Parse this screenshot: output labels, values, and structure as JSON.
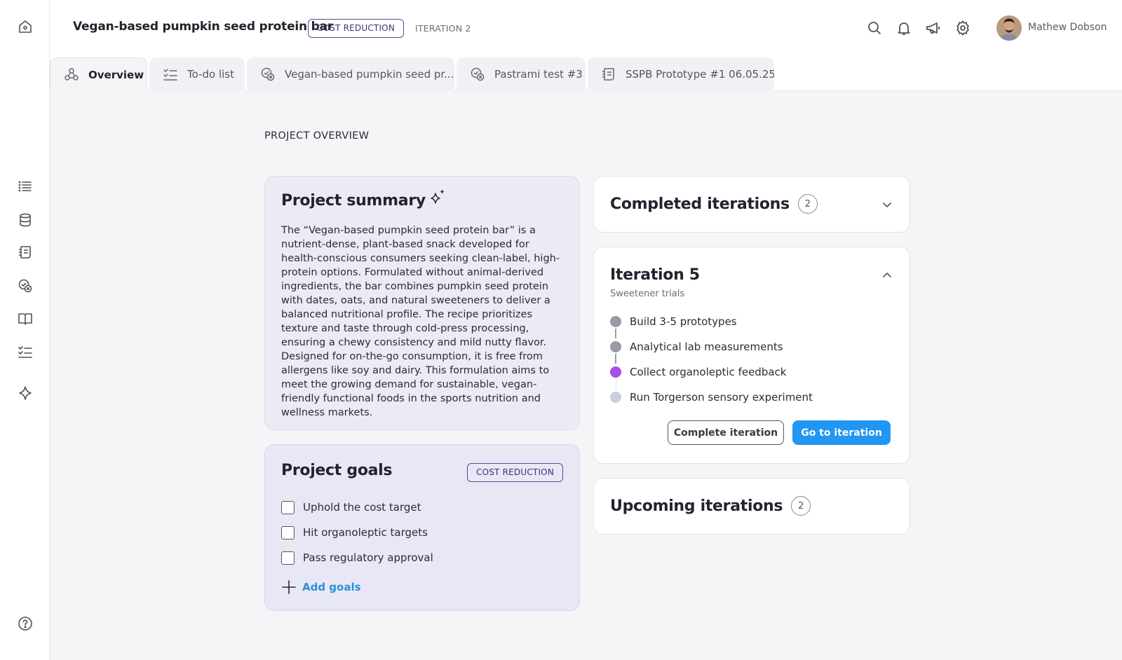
{
  "header": {
    "title": "Vegan-based pumpkin seed protein bar",
    "badge": "COST REDUCTION",
    "iteration": "ITERATION 2",
    "user_name": "Mathew Dobson"
  },
  "tabs": [
    {
      "label": "Overview",
      "icon": "molecule-icon",
      "active": true
    },
    {
      "label": "To-do list",
      "icon": "checklist-icon",
      "active": false
    },
    {
      "label": "Vegan-based pumpkin seed pr...",
      "icon": "flask-check-icon",
      "active": false
    },
    {
      "label": "Pastrami test #3",
      "icon": "flask-check-icon",
      "active": false
    },
    {
      "label": "SSPB Prototype #1 06.05.25",
      "icon": "recipe-icon",
      "active": false
    }
  ],
  "overview": {
    "section_title": "PROJECT OVERVIEW",
    "summary": {
      "title": "Project summary",
      "text": "The “Vegan-based pumpkin seed protein bar” is a nutrient-dense, plant-based snack developed for health-conscious consumers seeking clean-label, high-protein options. Formulated without animal-derived ingredients, the bar combines pumpkin seed protein with dates, oats, and natural sweeteners to deliver a balanced nutritional profile. The recipe prioritizes texture and taste through cold-press processing, ensuring a chewy consistency and mild nutty flavor. Designed for on-the-go consumption, it is free from allergens like soy and dairy. This formulation aims to meet the growing demand for sustainable, vegan-friendly functional foods in the sports nutrition and wellness markets."
    },
    "goals": {
      "title": "Project goals",
      "badge": "COST REDUCTION",
      "items": [
        "Uphold the cost target",
        "Hit organoleptic targets",
        "Pass regulatory approval"
      ],
      "add_label": "Add goals"
    },
    "completed": {
      "title": "Completed iterations",
      "count": "2"
    },
    "current": {
      "title": "Iteration 5",
      "subtitle": "Sweetener trials",
      "steps": [
        {
          "label": "Build 3-5 prototypes",
          "status": "done"
        },
        {
          "label": "Analytical lab measurements",
          "status": "done"
        },
        {
          "label": "Collect organoleptic feedback",
          "status": "current"
        },
        {
          "label": "Run Torgerson sensory experiment",
          "status": "upcoming"
        }
      ],
      "complete_label": "Complete iteration",
      "go_label": "Go to iteration"
    },
    "upcoming": {
      "title": "Upcoming iterations",
      "count": "2"
    }
  },
  "colors": {
    "accent": "#2196f3",
    "badge": "#3f2f77",
    "step_done": "#9a9aa6",
    "step_current": "#a64ee8",
    "step_upcoming": "#c9cfdc"
  }
}
